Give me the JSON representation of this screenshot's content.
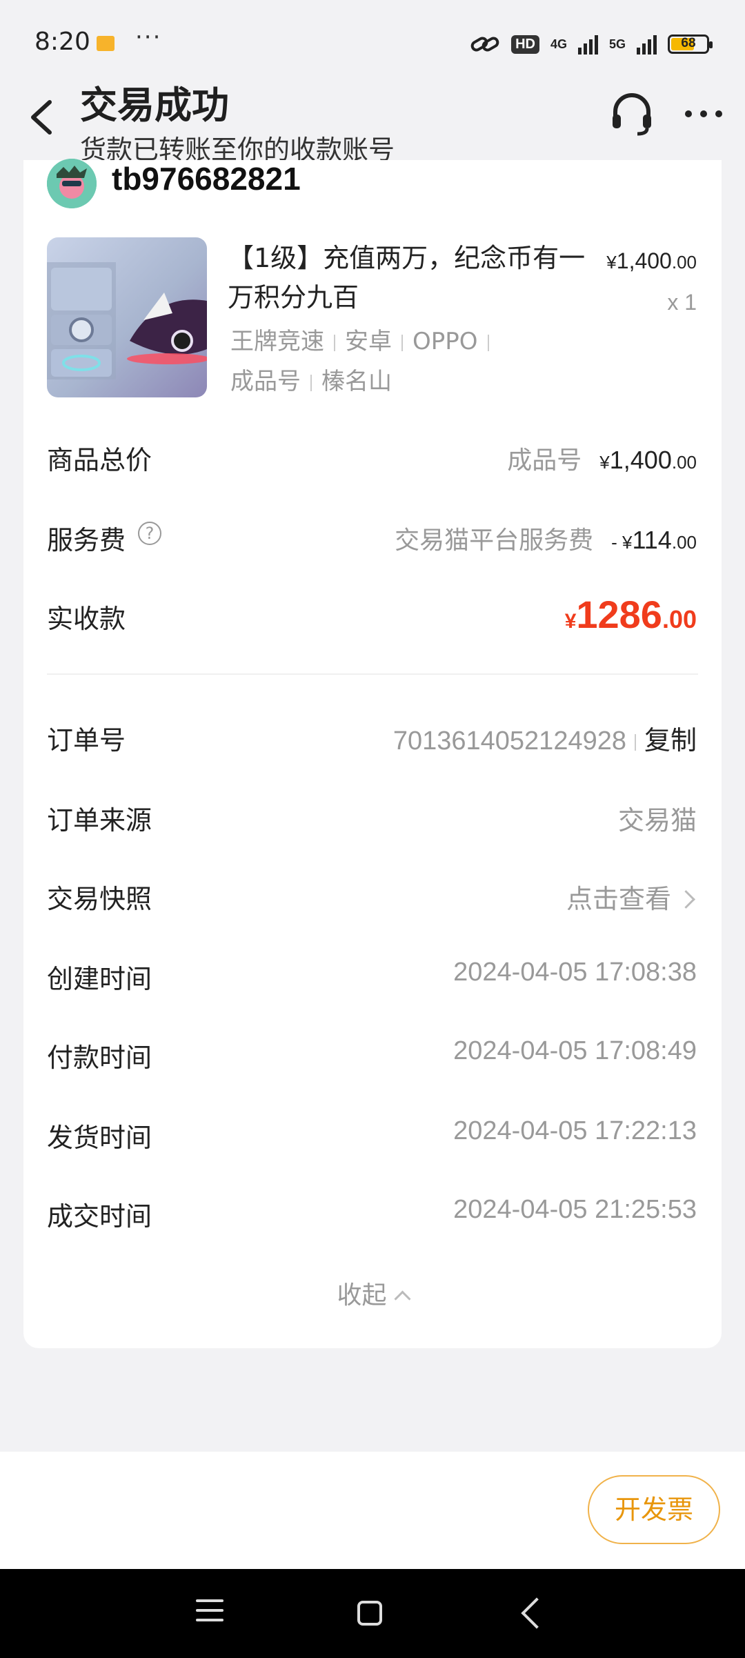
{
  "status_bar": {
    "time": "8:20",
    "dots": "···",
    "hd": "HD",
    "net1": "4G",
    "net2": "5G",
    "battery": "68"
  },
  "header": {
    "title": "交易成功",
    "subtitle": "货款已转账至你的收款账号"
  },
  "seller": {
    "name": "tb976682821"
  },
  "product": {
    "title": "【1级】充值两万，纪念币有一万积分九百",
    "tags_line1": [
      "王牌竞速",
      "安卓",
      "OPPO"
    ],
    "tags_line2": [
      "成品号",
      "榛名山"
    ],
    "price_symbol": "¥",
    "price_int": "1,400",
    "price_dec": ".00",
    "quantity": "x 1"
  },
  "totals": {
    "goods_label": "商品总价",
    "goods_desc": "成品号",
    "goods_symbol": "¥",
    "goods_int": "1,400",
    "goods_dec": ".00",
    "fee_label": "服务费",
    "fee_help": "?",
    "fee_desc": "交易猫平台服务费",
    "fee_symbol": "- ¥",
    "fee_int": "114",
    "fee_dec": ".00",
    "received_label": "实收款",
    "received_symbol": "¥",
    "received_int": "1286",
    "received_dec": ".00"
  },
  "order": {
    "id_label": "订单号",
    "id_value": "7013614052124928",
    "copy_label": "复制",
    "source_label": "订单来源",
    "source_value": "交易猫",
    "snapshot_label": "交易快照",
    "snapshot_value": "点击查看",
    "created_label": "创建时间",
    "created_value": "2024-04-05 17:08:38",
    "paid_label": "付款时间",
    "paid_value": "2024-04-05 17:08:49",
    "shipped_label": "发货时间",
    "shipped_value": "2024-04-05 17:22:13",
    "closed_label": "成交时间",
    "closed_value": "2024-04-05 21:25:53",
    "collapse_label": "收起"
  },
  "actions": {
    "invoice_label": "开发票"
  },
  "colors": {
    "accent_red": "#f03c1c",
    "invoice_orange": "#e8960c",
    "background": "#f2f2f4"
  }
}
